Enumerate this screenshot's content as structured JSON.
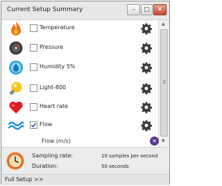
{
  "window": {
    "title": "Current Setup Summary",
    "controls": {
      "minimize": "–",
      "maximize": "□",
      "close": "✕"
    }
  },
  "sensors": [
    {
      "label": "Temperature",
      "checked": false,
      "icon": "flame-icon",
      "color": "#e8741c"
    },
    {
      "label": "Pressure",
      "checked": false,
      "icon": "gauge-icon",
      "color": "#3a3a3a"
    },
    {
      "label": "Humidity 5%",
      "checked": false,
      "icon": "droplet-icon",
      "color": "#2e9fd6"
    },
    {
      "label": "Light-800",
      "checked": false,
      "icon": "lightbulb-icon",
      "color": "#f0b400"
    },
    {
      "label": "Heart rate",
      "checked": false,
      "icon": "heart-icon",
      "color": "#e11b22"
    },
    {
      "label": "Flow",
      "checked": true,
      "icon": "waves-icon",
      "color": "#1c8fd1"
    }
  ],
  "flow_sub": {
    "label": "Flow (m/s)",
    "remove_symbol": "✕"
  },
  "summary": {
    "sampling_rate_label": "Sampling rate:",
    "sampling_rate_value": "10 samples per second",
    "duration_label": "Duration:",
    "duration_value": "50 seconds"
  },
  "footer": {
    "full_setup_label": "Full Setup >>"
  },
  "colors": {
    "accent_purple": "#5a3c8c",
    "clock_orange": "#f07a1e"
  }
}
